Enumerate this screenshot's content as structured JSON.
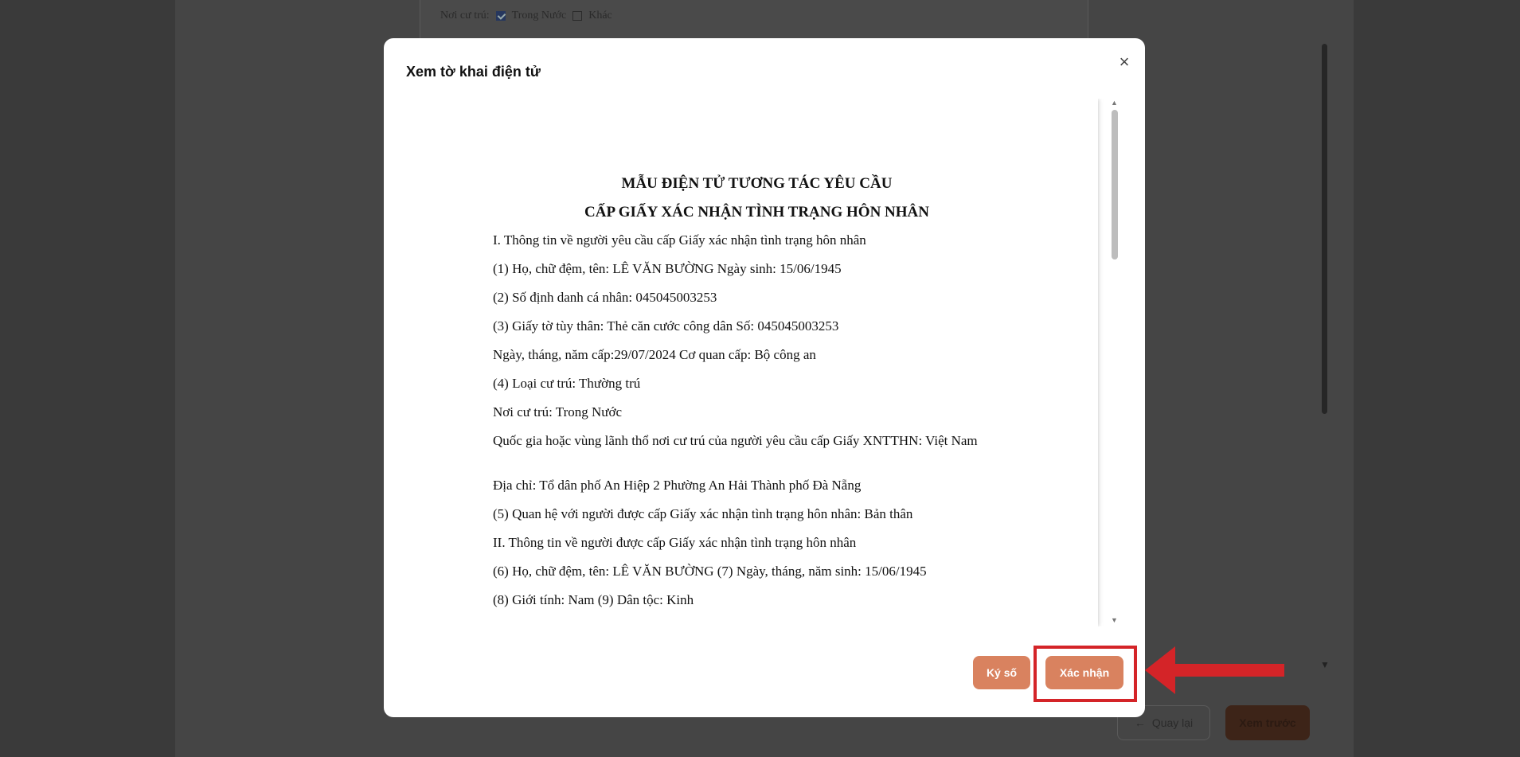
{
  "background": {
    "residence_label": "Nơi cư trú:",
    "option_domestic": "Trong Nước",
    "option_other": "Khác",
    "back_button": "Quay lại",
    "preview_button": "Xem trước"
  },
  "modal": {
    "title": "Xem tờ khai điện tử",
    "close_label": "×",
    "sign_button": "Ký số",
    "confirm_button": "Xác nhận"
  },
  "document": {
    "title_line1": "MẪU ĐIỆN TỬ TƯƠNG TÁC YÊU CẦU",
    "title_line2": "CẤP GIẤY XÁC NHẬN TÌNH TRẠNG HÔN NHÂN",
    "lines": [
      "I. Thông tin về người yêu cầu cấp Giấy xác nhận tình trạng hôn nhân",
      "(1) Họ, chữ đệm, tên: LÊ VĂN BƯỜNG Ngày sinh: 15/06/1945",
      "(2) Số định danh cá nhân: 045045003253",
      "(3) Giấy tờ tùy thân: Thẻ căn cước công dân Số: 045045003253",
      "Ngày, tháng, năm cấp:29/07/2024 Cơ quan cấp: Bộ công an",
      "(4) Loại cư trú: Thường trú",
      "Nơi cư trú: Trong Nước",
      "Quốc gia hoặc vùng lãnh thổ nơi cư trú của người yêu cầu cấp Giấy XNTTHN: Việt Nam",
      "Địa chỉ: Tổ dân phố An Hiệp 2 Phường An Hải Thành phố Đà Nẵng",
      " (5) Quan hệ với người được cấp Giấy xác nhận tình trạng hôn nhân: Bản thân",
      "II. Thông tin về người được cấp Giấy xác nhận tình trạng hôn nhân",
      "(6) Họ, chữ đệm, tên: LÊ VĂN BƯỜNG (7) Ngày, tháng, năm sinh: 15/06/1945",
      "(8) Giới tính: Nam (9) Dân tộc: Kinh"
    ]
  },
  "colors": {
    "accent_button": "#d9825f",
    "annotation_red": "#d42428"
  }
}
